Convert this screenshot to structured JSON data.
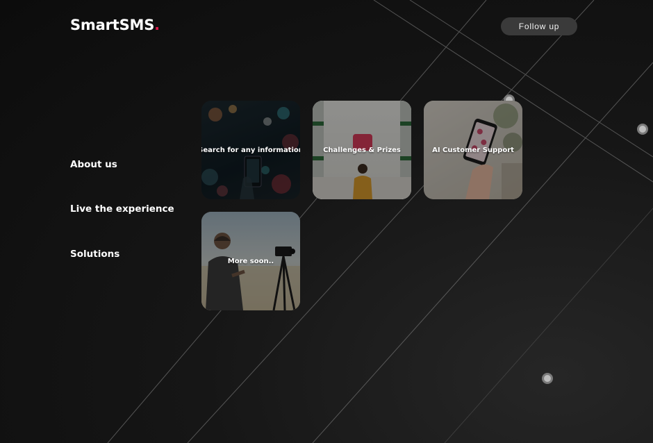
{
  "header": {
    "logo_text": "SmartSMS",
    "logo_accent": ".",
    "accent_color": "#e0184a",
    "follow_button_label": "Follow up"
  },
  "nav": {
    "items": [
      {
        "label": "About us"
      },
      {
        "label": "Live the experience"
      },
      {
        "label": "Solutions"
      }
    ]
  },
  "cards": [
    {
      "label": "Search for any information",
      "image": "phone-city-lights"
    },
    {
      "label": "Challenges & Prizes",
      "image": "woman-with-heart-balloon"
    },
    {
      "label": "AI Customer Support",
      "image": "hand-holding-phone"
    },
    {
      "label": "More soon..",
      "image": "man-with-camera-tripod"
    }
  ]
}
